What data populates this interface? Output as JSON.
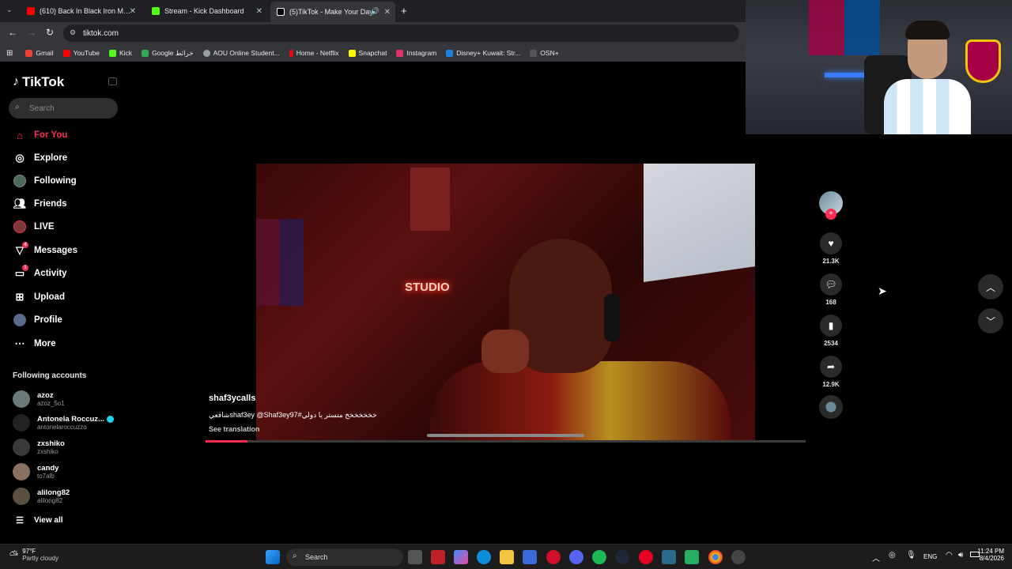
{
  "browser": {
    "tabs": [
      {
        "title": "(610) Back In Black Iron Man - Yo",
        "favicon_color": "#ff0000"
      },
      {
        "title": "Stream - Kick Dashboard",
        "favicon_color": "#53fc18"
      },
      {
        "title": "(5)TikTok - Make Your Day",
        "favicon_color": "#ffffff"
      }
    ],
    "url": "tiktok.com",
    "bookmarks": [
      {
        "label": "Gmail",
        "color": "#ea4335"
      },
      {
        "label": "YouTube",
        "color": "#ff0000"
      },
      {
        "label": "Kick",
        "color": "#53fc18"
      },
      {
        "label": "Google خرائط",
        "color": "#34a853"
      },
      {
        "label": "AOU Online Student...",
        "color": "#9aa0a6"
      },
      {
        "label": "Home - Netflix",
        "color": "#e50914"
      },
      {
        "label": "Snapchat",
        "color": "#fffc00"
      },
      {
        "label": "Instagram",
        "color": "#e1306c"
      },
      {
        "label": "Disney+ Kuwait: Str...",
        "color": "#1f80e0"
      },
      {
        "label": "OSN+",
        "color": "#ffffff"
      }
    ]
  },
  "sidebar": {
    "logo": "TikTok",
    "search_placeholder": "Search",
    "nav": [
      {
        "label": "For You",
        "icon": "home-icon"
      },
      {
        "label": "Explore",
        "icon": "compass-icon"
      },
      {
        "label": "Following",
        "icon": "following-icon"
      },
      {
        "label": "Friends",
        "icon": "friends-icon"
      },
      {
        "label": "LIVE",
        "icon": "live-icon"
      },
      {
        "label": "Messages",
        "icon": "messages-icon",
        "badge": "4"
      },
      {
        "label": "Activity",
        "icon": "activity-icon",
        "badge": "1"
      },
      {
        "label": "Upload",
        "icon": "upload-icon"
      },
      {
        "label": "Profile",
        "icon": "profile-icon"
      },
      {
        "label": "More",
        "icon": "more-icon"
      }
    ],
    "following_header": "Following accounts",
    "accounts": [
      {
        "name": "azoz",
        "handle": "azoz_5o1"
      },
      {
        "name": "Antonela Roccuz...",
        "handle": "antonelaroccuzzo",
        "verified": true
      },
      {
        "name": "zxshiko",
        "handle": "zxshiko"
      },
      {
        "name": "candy",
        "handle": "to7alb"
      },
      {
        "name": "alilong82",
        "handle": "alilong82"
      }
    ],
    "view_all": "View all"
  },
  "video": {
    "author": "shaf3ycalls",
    "caption": "خخخخخخخ متستر يا دولي#shaf3ey @Shaf3ey97شافعي",
    "see_translation": "See translation",
    "progress": 0.07,
    "neon_sign": "STUDIO"
  },
  "actions": {
    "likes": "21.3K",
    "comments": "168",
    "saves": "2534",
    "shares": "12.9K"
  },
  "taskbar": {
    "weather_temp": "97°F",
    "weather_desc": "Partly cloudy",
    "search": "Search",
    "lang": "ENG",
    "time": "11:24 PM",
    "date": "8/4/2026"
  }
}
